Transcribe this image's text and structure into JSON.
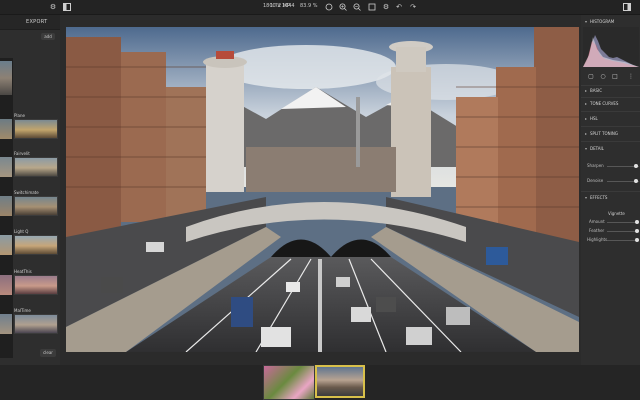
{
  "toolbar": {
    "dimensions": "1800 x 1044",
    "megapixels": "1.72 MP",
    "zoom": "83.9 %",
    "icons": [
      "gear-icon",
      "panel-icon",
      "fit-icon",
      "zoom-in-icon",
      "zoom-out-icon",
      "crop-icon",
      "fullscreen-icon",
      "undo-icon",
      "redo-icon",
      "sidebar-icon"
    ]
  },
  "left_panel": {
    "export_label": "EXPORT",
    "add_label": "add",
    "clear_label": "clear",
    "presets": [
      {
        "label": "Plane"
      },
      {
        "label": "Fairvelit"
      },
      {
        "label": "Switchimate"
      },
      {
        "label": "Light Q"
      },
      {
        "label": "HeatThis"
      },
      {
        "label": "MalTime"
      }
    ]
  },
  "right_panel": {
    "histogram_label": "HISTOGRAM",
    "sections": {
      "basic": "BASIC",
      "tone_curves": "TONE CURVES",
      "hsl": "HSL",
      "split_toning": "SPLIT TONING",
      "detail": "DETAIL",
      "effects": "EFFECTS"
    },
    "detail_sliders": [
      {
        "label": "Sharpen",
        "value": 0.9
      },
      {
        "label": "Denoise",
        "value": 0.9
      }
    ],
    "effects_group": "Vignette",
    "effects_sliders": [
      {
        "label": "Amount",
        "value": 0.95
      },
      {
        "label": "Feather",
        "value": 0.95
      },
      {
        "label": "Highlights",
        "value": 0.95
      }
    ]
  },
  "colors": {
    "accent": "#d8c04a",
    "panel": "#2e2e2e",
    "toolbar": "#232323"
  }
}
